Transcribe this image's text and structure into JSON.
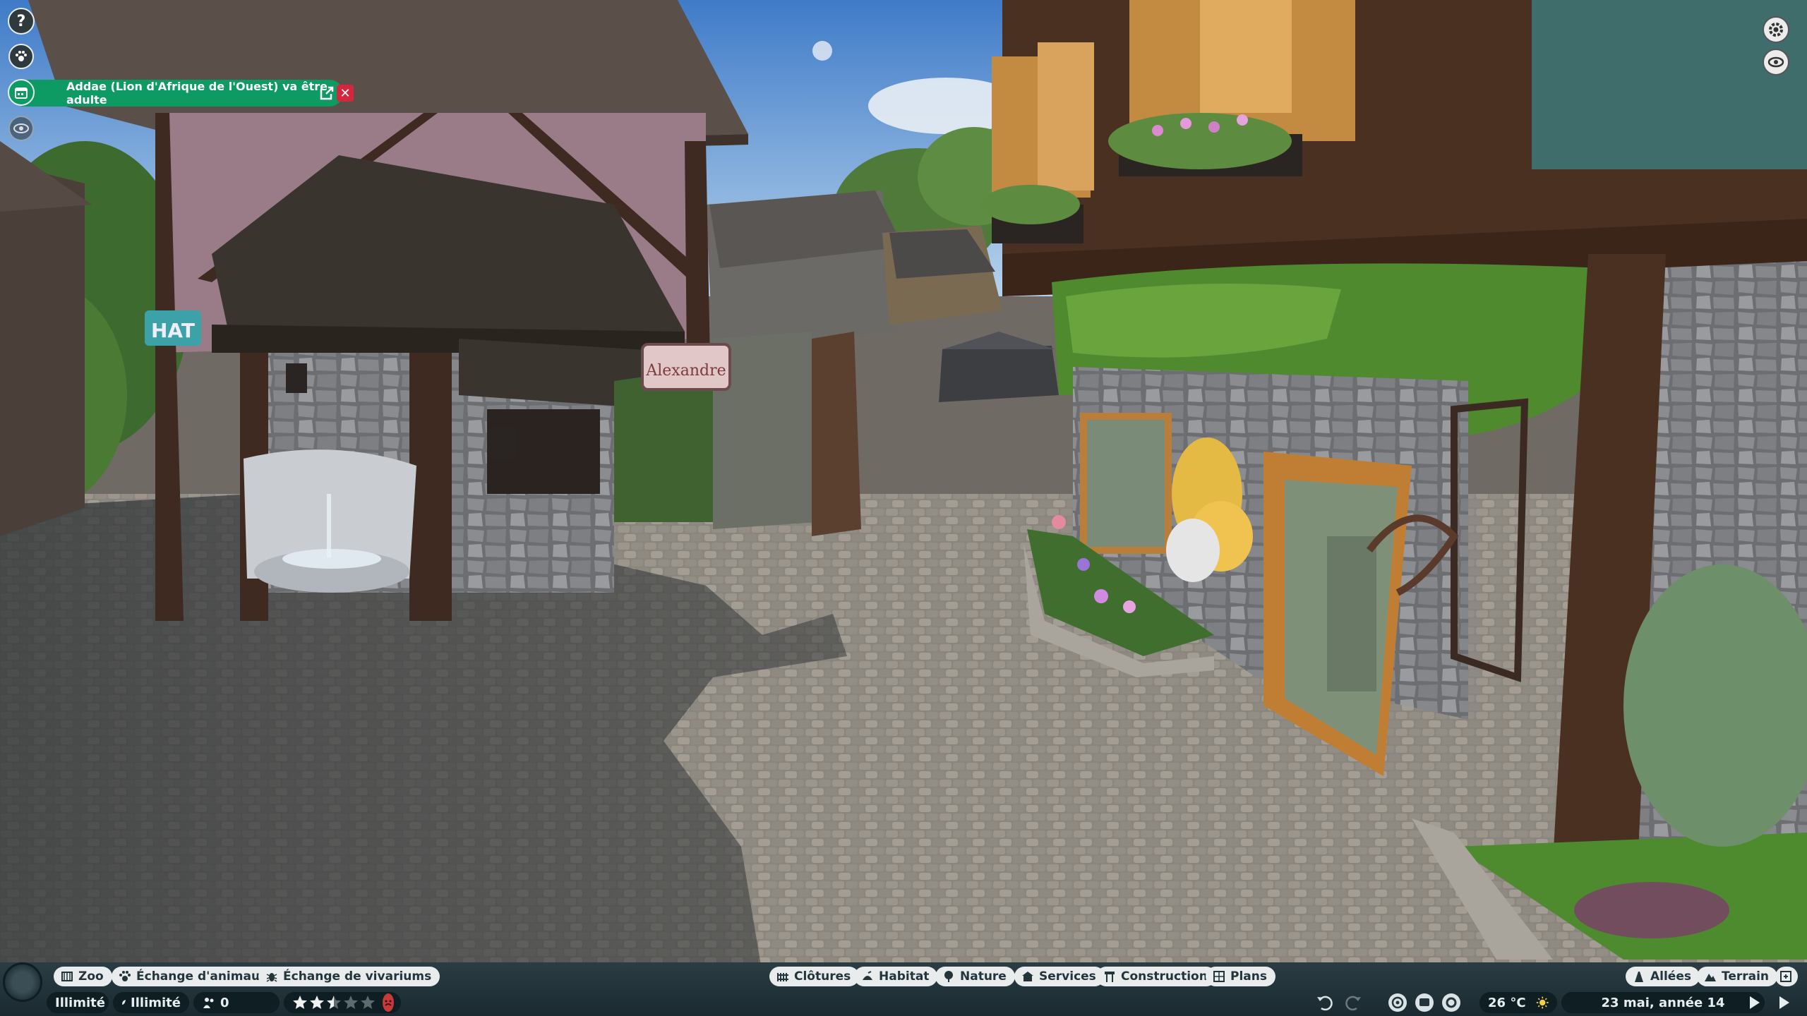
{
  "notification": {
    "text": "Addae (Lion d'Afrique de l'Ouest) va être adulte"
  },
  "scene": {
    "shop_sign": "Alexandre",
    "distant_sign": "HAT"
  },
  "toolbar_left": [
    {
      "id": "zoo",
      "label": "Zoo",
      "icon": "zoo-icon"
    },
    {
      "id": "animal-exchange",
      "label": "Échange d'animaux",
      "icon": "paw-icon"
    },
    {
      "id": "vivarium-exchange",
      "label": "Échange de vivariums",
      "icon": "bug-icon"
    }
  ],
  "toolbar_center": [
    {
      "id": "fences",
      "label": "Clôtures",
      "icon": "fence-icon"
    },
    {
      "id": "habitat",
      "label": "Habitat",
      "icon": "habitat-icon"
    },
    {
      "id": "nature",
      "label": "Nature",
      "icon": "tree-icon"
    },
    {
      "id": "services",
      "label": "Services",
      "icon": "building-icon"
    },
    {
      "id": "construction",
      "label": "Construction",
      "icon": "construction-icon"
    },
    {
      "id": "plans",
      "label": "Plans",
      "icon": "blueprint-icon"
    }
  ],
  "toolbar_right": [
    {
      "id": "paths",
      "label": "Allées",
      "icon": "path-icon"
    },
    {
      "id": "terrain",
      "label": "Terrain",
      "icon": "mountain-icon"
    }
  ],
  "status": {
    "money": "Illimité",
    "research": "Illimité",
    "guests": "0",
    "rating_stars": 2.5,
    "rating_max": 5,
    "temperature": "26 °C",
    "weather": "sun-icon",
    "date": "23 mai, année 14"
  },
  "colors": {
    "notification_green": "#0d9a63",
    "close_red": "#d3273e",
    "bar_dark": "#22343a",
    "pill_bg": "#e9ecec",
    "star_fill": "#f2f2f2",
    "mood_red": "#c83a3a"
  }
}
